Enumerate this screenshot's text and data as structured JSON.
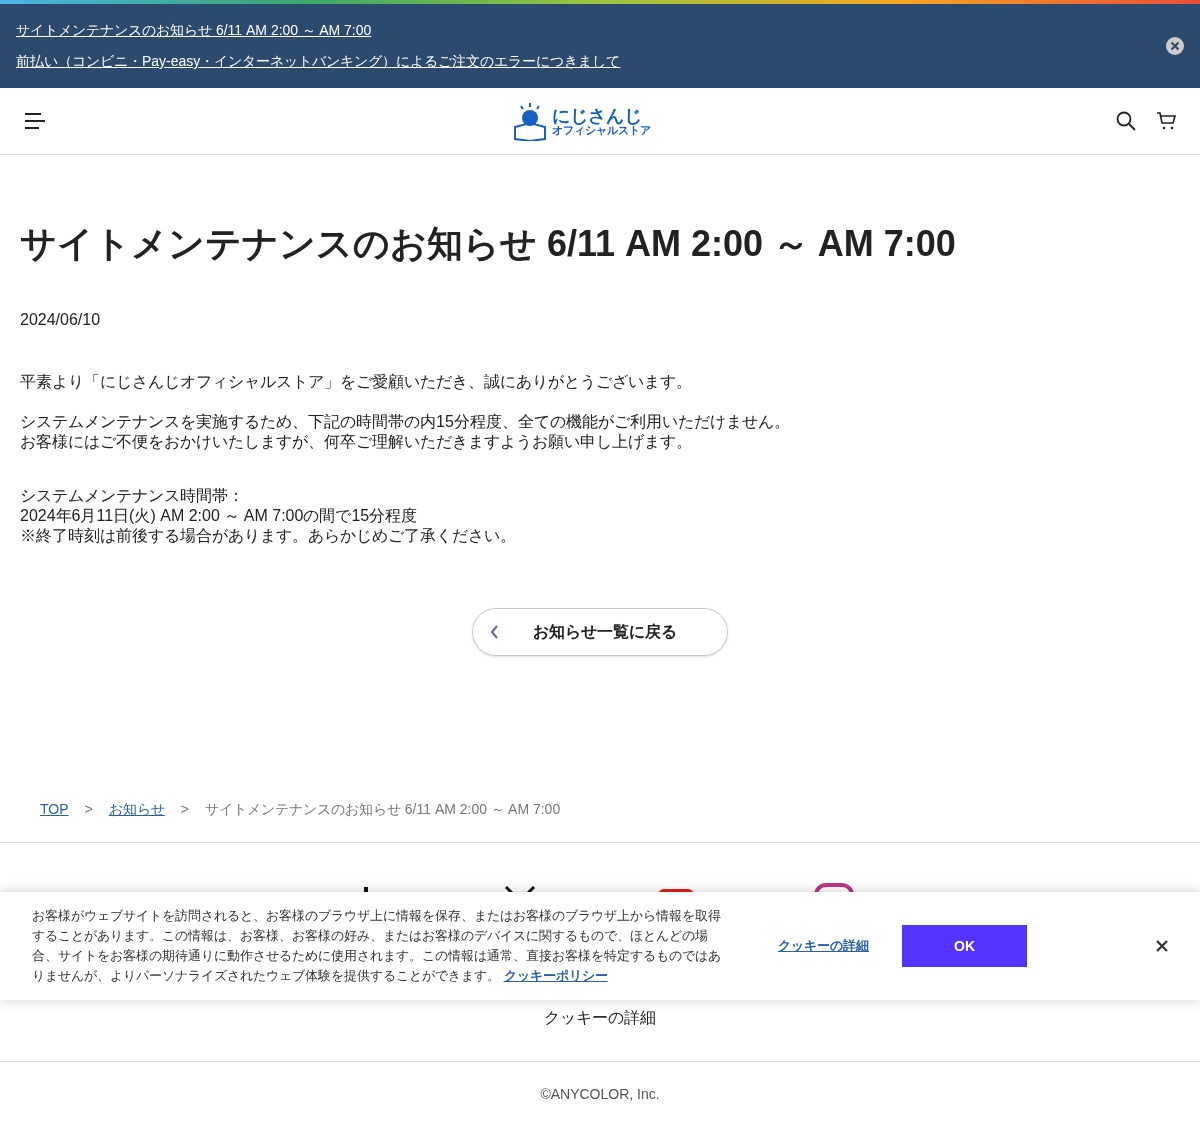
{
  "notice_bar": {
    "links": [
      "サイトメンテナンスのお知らせ 6/11 AM 2:00 ～ AM 7:00",
      "前払い（コンビニ・Pay-easy・インターネットバンキング）によるご注文のエラーにつきまして"
    ]
  },
  "header": {
    "logo": {
      "line_1": "にじさんじ",
      "line_2": "オフィシャルストア"
    }
  },
  "article": {
    "title": "サイトメンテナンスのお知らせ 6/11 AM 2:00 ～ AM 7:00",
    "date": "2024/06/10",
    "paragraphs": [
      [
        "平素より「にじさんじオフィシャルストア」をご愛顧いただき、誠にありがとうございます。"
      ],
      [
        "システムメンテナンスを実施するため、下記の時間帯の内15分程度、全ての機能がご利用いただけません。",
        "お客様にはご不便をおかけいたしますが、何卒ご理解いただきますようお願い申し上げます。"
      ],
      [
        "システムメンテナンス時間帯：",
        "2024年6月11日(火) AM 2:00 ～ AM 7:00の間で15分程度",
        "※終了時刻は前後する場合があります。あらかじめご了承ください。"
      ]
    ],
    "back_button": "お知らせ一覧に戻る"
  },
  "breadcrumb": [
    {
      "label": "TOP",
      "kind": "link"
    },
    {
      "label": "お知らせ",
      "kind": "link"
    },
    {
      "label": "サイトメンテナンスのお知らせ 6/11 AM 2:00 ～ AM 7:00",
      "kind": "current"
    }
  ],
  "breadcrumb_separator": ">",
  "footer": {
    "cookie_link": "クッキーの詳細",
    "copyright": "©ANYCOLOR, Inc."
  },
  "cookie_banner": {
    "text": "お客様がウェブサイトを訪問されると、お客様のブラウザ上に情報を保存、またはお客様のブラウザ上から情報を取得することがあります。この情報は、お客様、お客様の好み、またはお客様のデバイスに関するもので、ほとんどの場合、サイトをお客様の期待通りに動作させるために使用されます。この情報は通常、直接お客様を特定するものではありませんが、よりパーソナライズされたウェブ体験を提供することができます。",
    "policy_link": "クッキーポリシー",
    "details_link": "クッキーの詳細",
    "ok_button": "OK"
  }
}
